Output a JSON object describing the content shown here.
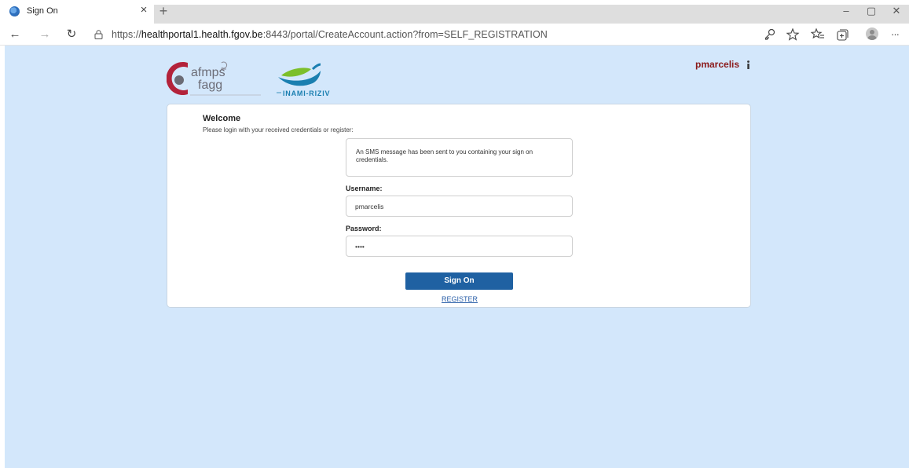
{
  "browser": {
    "tab": {
      "title": "Sign On",
      "close_glyph": "×"
    },
    "new_tab_glyph": "+",
    "window_controls": {
      "minimize": "–",
      "maximize": "▢",
      "close": "✕"
    },
    "nav": {
      "back": "←",
      "forward": "→",
      "refresh": "↻"
    },
    "address": {
      "scheme": "https://",
      "host": "healthportal1.health.fgov.be",
      "rest": ":8443/portal/CreateAccount.action?from=SELF_REGISTRATION"
    },
    "toolbar_icons": [
      "key-icon",
      "read-aloud-icon",
      "favorites-icon",
      "collections-icon",
      "profile-icon",
      "more-icon"
    ],
    "more_glyph": "···"
  },
  "header": {
    "logos": {
      "afmps": {
        "line1": "afmps",
        "line2": "fagg"
      },
      "inami": {
        "text": "INAMI-RIZIV"
      }
    },
    "user": {
      "name": "pmarcelis"
    }
  },
  "login": {
    "title": "Welcome",
    "subtitle": "Please login with your received credentials or register:",
    "message": "An SMS message has been sent to you containing your sign on credentials.",
    "username_label": "Username:",
    "username_value": "pmarcelis",
    "password_label": "Password:",
    "password_value": "abcd",
    "signon_label": "Sign On",
    "register_label": "REGISTER"
  },
  "colors": {
    "page_bg": "#d3e7fb",
    "primary_button": "#1f61a2",
    "user_name": "#8b1a1a",
    "link": "#2a5fa8",
    "afmps_red": "#b3223a",
    "afmps_grey": "#6b6b75",
    "inami_green": "#7cbf2a",
    "inami_blue": "#1a7fb0"
  }
}
